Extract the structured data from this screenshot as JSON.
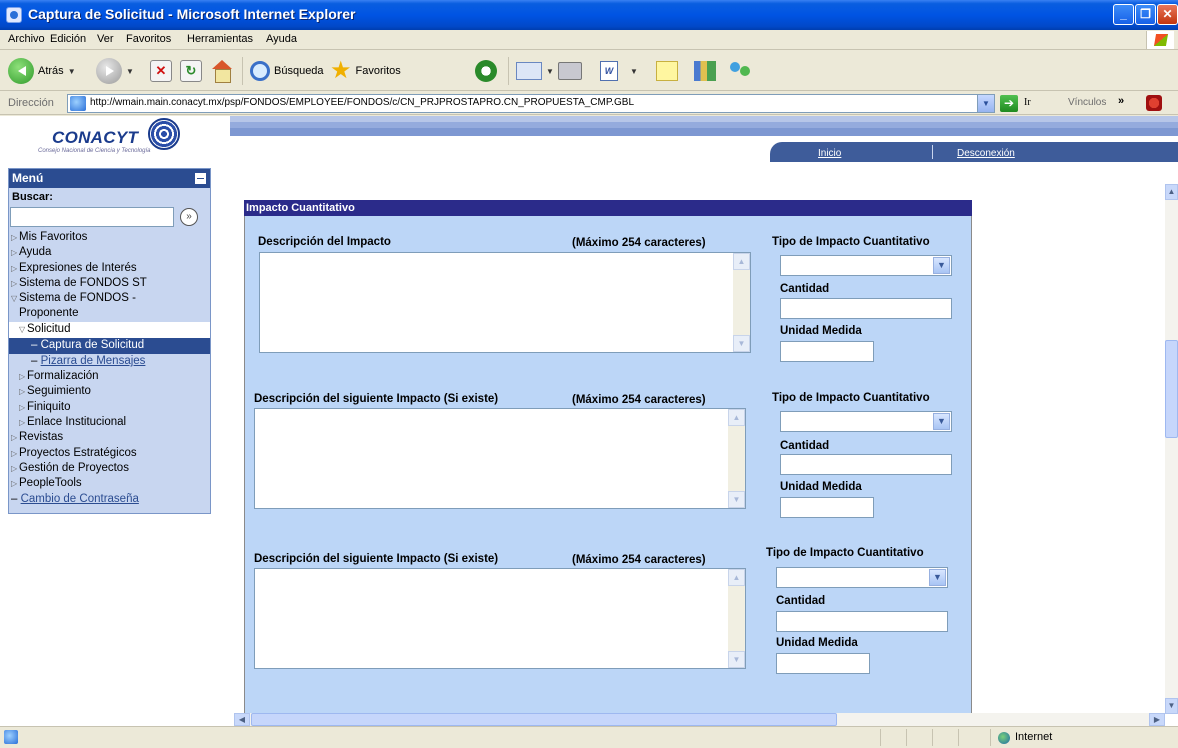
{
  "window": {
    "title": "Captura de Solicitud - Microsoft Internet Explorer"
  },
  "menubar": {
    "items": [
      "Archivo",
      "Edición",
      "Ver",
      "Favoritos",
      "Herramientas",
      "Ayuda"
    ]
  },
  "toolbar": {
    "back_label": "Atrás",
    "search_label": "Búsqueda",
    "favorites_label": "Favoritos"
  },
  "address": {
    "label": "Dirección",
    "url": "http://wmain.main.conacyt.mx/psp/FONDOS/EMPLOYEE/FONDOS/c/CN_PRJPROSTAPRO.CN_PROPUESTA_CMP.GBL",
    "go_label": "Ir",
    "links_label": "Vínculos"
  },
  "banner": {
    "logo_text": "CONACYT",
    "logo_sub": "Consejo Nacional de Ciencia y Tecnología",
    "links": [
      "Inicio",
      "Desconexión"
    ]
  },
  "sidebar": {
    "title": "Menú",
    "search_label": "Buscar:",
    "search_value": "",
    "items": [
      "Mis Favoritos",
      "Ayuda",
      "Expresiones de Interés",
      "Sistema de FONDOS ST",
      "Sistema de FONDOS -",
      "Proponente",
      "Solicitud",
      "Captura de Solicitud",
      "Pizarra de Mensajes",
      "Formalización",
      "Seguimiento",
      "Finiquito",
      "Enlace Institucional",
      "Revistas",
      "Proyectos Estratégicos",
      "Gestión de Proyectos",
      "PeopleTools",
      "Cambio de Contraseña"
    ]
  },
  "section": {
    "title": "Impacto Cuantitativo",
    "max_note": "(Máximo 254 caracteres)",
    "blocks": [
      {
        "desc_label": "Descripción del Impacto",
        "desc_value": "",
        "type_label": "Tipo de Impacto Cuantitativo",
        "type_value": "",
        "qty_label": "Cantidad",
        "qty_value": "",
        "unit_label": "Unidad Medida",
        "unit_value": ""
      },
      {
        "desc_label": "Descripción del siguiente Impacto (Si existe)",
        "desc_value": "",
        "type_label": "Tipo de Impacto Cuantitativo",
        "type_value": "",
        "qty_label": "Cantidad",
        "qty_value": "",
        "unit_label": "Unidad Medida",
        "unit_value": ""
      },
      {
        "desc_label": "Descripción del siguiente Impacto (Si existe)",
        "desc_value": "",
        "type_label": "Tipo de Impacto Cuantitativo",
        "type_value": "",
        "qty_label": "Cantidad",
        "qty_value": "",
        "unit_label": "Unidad Medida",
        "unit_value": ""
      }
    ]
  },
  "statusbar": {
    "zone": "Internet"
  },
  "colors": {
    "menu_header": "#2b4c91",
    "section_header": "#2b2b8a",
    "section_body": "#bcd6f7",
    "titlebar": "#0054e3"
  }
}
